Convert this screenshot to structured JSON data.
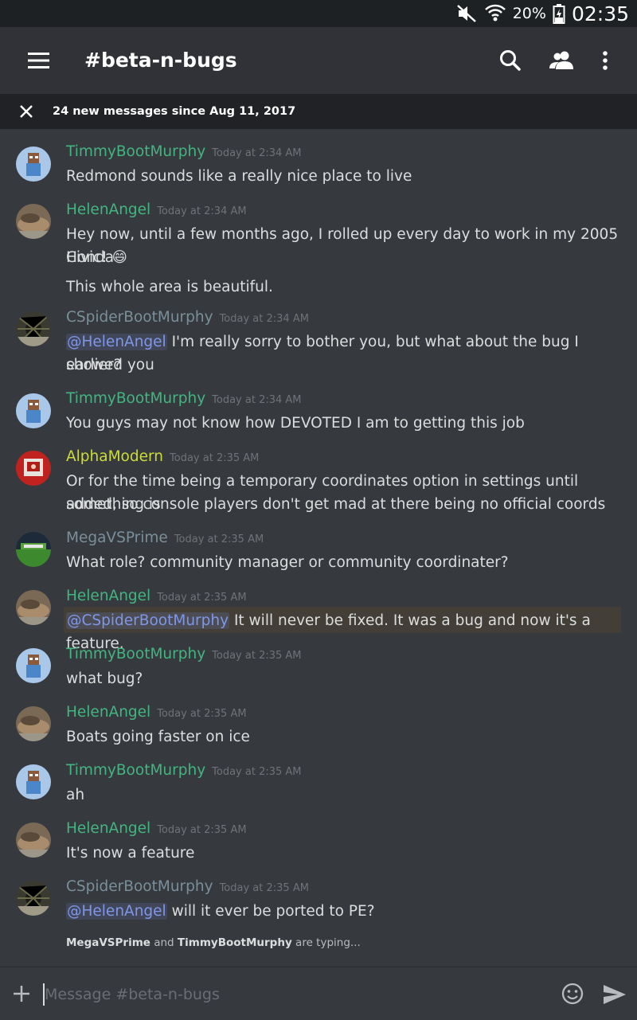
{
  "status_bar": {
    "battery_percent": "20%",
    "time": "02:35"
  },
  "header": {
    "channel_title": "#beta-n-bugs"
  },
  "banner": {
    "text": "24 new messages since Aug 11, 2017"
  },
  "colors": {
    "green_user": "#43b581",
    "yellow_user": "#cddc39",
    "gray_user": "#7a8f99",
    "mention": "#7f97e6",
    "highlight": "#433f38"
  },
  "messages": [
    {
      "author": "TimmyBootMurphy",
      "timestamp": "Today at 2:34 AM",
      "lines": [
        "Redmond sounds like a really nice place to live"
      ]
    },
    {
      "author": "HelenAngel",
      "timestamp": "Today at 2:34 AM",
      "lines": [
        "Hey now, until a few months ago, I rolled up every day to work in my 2005 Honda",
        "Civic! ",
        "This whole area is beautiful."
      ],
      "emoji": "😄"
    },
    {
      "author": "CSpiderBootMurphy",
      "timestamp": "Today at 2:34 AM",
      "mention": "@HelenAngel",
      "lines": [
        " I'm really sorry to bother you, but what about the bug I showed you",
        "earlier?"
      ]
    },
    {
      "author": "TimmyBootMurphy",
      "timestamp": "Today at 2:34 AM",
      "lines": [
        "You guys may not know how DEVOTED I am to getting this job"
      ]
    },
    {
      "author": "AlphaModern",
      "timestamp": "Today at 2:35 AM",
      "lines": [
        "Or for the time being a temporary coordinates option in settings until something is",
        "added, so console players don't get mad at there being no official coords"
      ]
    },
    {
      "author": "MegaVSPrime",
      "timestamp": "Today at 2:35 AM",
      "lines": [
        "What role? community manager or community coordinater?"
      ]
    },
    {
      "author": "HelenAngel",
      "timestamp": "Today at 2:35 AM",
      "mention": "@CSpiderBootMurphy",
      "lines": [
        " It will never be fixed. It was a bug and now it's a feature."
      ]
    },
    {
      "author": "TimmyBootMurphy",
      "timestamp": "Today at 2:35 AM",
      "lines": [
        "what bug?"
      ]
    },
    {
      "author": "HelenAngel",
      "timestamp": "Today at 2:35 AM",
      "lines": [
        "Boats going faster on ice"
      ]
    },
    {
      "author": "TimmyBootMurphy",
      "timestamp": "Today at 2:35 AM",
      "lines": [
        "ah"
      ]
    },
    {
      "author": "HelenAngel",
      "timestamp": "Today at 2:35 AM",
      "lines": [
        "It's now a feature"
      ]
    },
    {
      "author": "CSpiderBootMurphy",
      "timestamp": "Today at 2:35 AM",
      "mention": "@HelenAngel",
      "lines": [
        " will it ever be ported to PE?"
      ]
    }
  ],
  "typing": {
    "user1": "MegaVSPrime",
    "joiner": " and ",
    "user2": "TimmyBootMurphy",
    "suffix": " are typing..."
  },
  "composer": {
    "placeholder": "Message #beta-n-bugs"
  }
}
